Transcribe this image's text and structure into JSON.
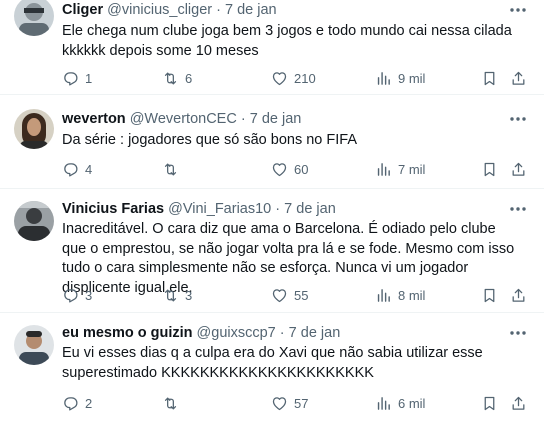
{
  "tweets": [
    {
      "name": "Cliger",
      "handle": "@vinicius_cliger",
      "dot": "·",
      "date": "7 de jan",
      "text": "Ele chega num clube joga bem 3 jogos e todo mundo cai nessa cilada kkkkkk depois some 10 meses",
      "replies": "1",
      "retweets": "6",
      "likes": "210",
      "views": "9 mil"
    },
    {
      "name": "weverton",
      "handle": "@WevertonCEC",
      "dot": "·",
      "date": "7 de jan",
      "text": "Da série : jogadores que só são bons no FIFA",
      "replies": "4",
      "retweets": "",
      "likes": "60",
      "views": "7 mil"
    },
    {
      "name": "Vinicius Farias",
      "handle": "@Vini_Farias10",
      "dot": "·",
      "date": "7 de jan",
      "text": "Inacreditável. O cara diz que ama o Barcelona. É odiado pelo clube que o emprestou, se não jogar volta pra lá e se fode. Mesmo com isso tudo o cara simplesmente não se esforça. Nunca vi um jogador displicente igual ele.",
      "replies": "3",
      "retweets": "3",
      "likes": "55",
      "views": "8 mil"
    },
    {
      "name": "eu mesmo o guizin",
      "handle": "@guixsccp7",
      "dot": "·",
      "date": "7 de jan",
      "text": "Eu vi esses dias q a culpa era do Xavi que não sabia utilizar esse superestimado KKKKKKKKKKKKKKKKKKKKKK",
      "replies": "2",
      "retweets": "",
      "likes": "57",
      "views": "6 mil"
    }
  ],
  "icons": {
    "reply": "reply-icon",
    "retweet": "retweet-icon",
    "like": "heart-icon",
    "views": "views-icon",
    "bookmark": "bookmark-icon",
    "share": "share-icon",
    "more": "more-icon"
  },
  "colors": {
    "muted": "#536471",
    "text": "#0f1419",
    "border": "#eff3f4"
  }
}
